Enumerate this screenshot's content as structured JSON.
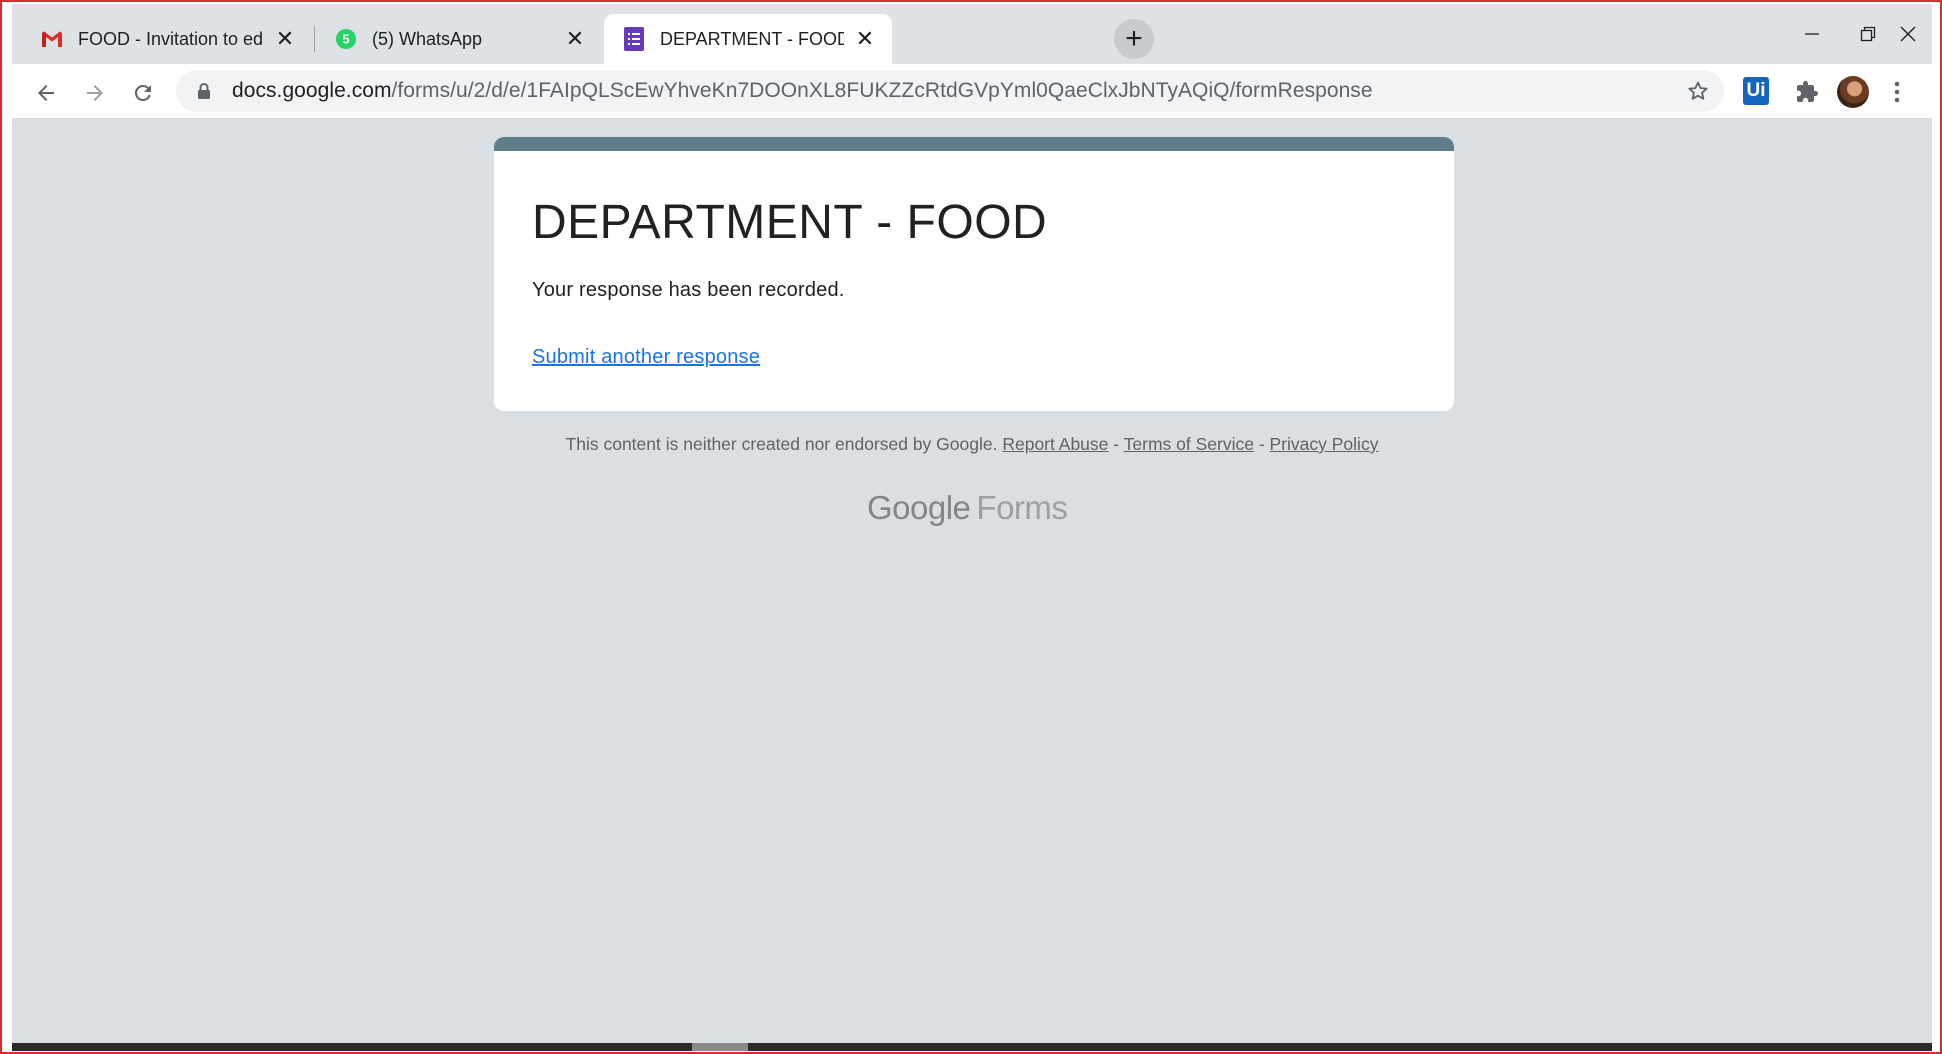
{
  "browser": {
    "tabs": [
      {
        "title": "FOOD - Invitation to edit - varshi",
        "icon": "gmail-icon",
        "active": false
      },
      {
        "title": "(5) WhatsApp",
        "icon": "whatsapp-icon",
        "badge": "5",
        "active": false
      },
      {
        "title": "DEPARTMENT - FOOD",
        "icon": "google-forms-icon",
        "active": true
      }
    ],
    "new_tab_label": "+",
    "window_controls": {
      "minimize": "minimize-icon",
      "restore": "restore-icon",
      "close": "close-icon"
    },
    "address": {
      "host": "docs.google.com",
      "path": "/forms/u/2/d/e/1FAIpQLScEwYhveKn7DOOnXL8FUKZZcRtdGVpYml0QaeClxJbNTyAQiQ/formResponse"
    },
    "extensions": {
      "uipath_label": "Ui"
    }
  },
  "form": {
    "title": "DEPARTMENT - FOOD",
    "message": "Your response has been recorded.",
    "submit_another": "Submit another response",
    "header_color": "#607d8b"
  },
  "footer": {
    "disclaimer": "This content is neither created nor endorsed by Google.",
    "report_abuse": "Report Abuse",
    "sep1": "-",
    "terms": "Terms of Service",
    "sep2": "-",
    "privacy": "Privacy Policy",
    "brand_google": "Google",
    "brand_forms": "Forms"
  }
}
